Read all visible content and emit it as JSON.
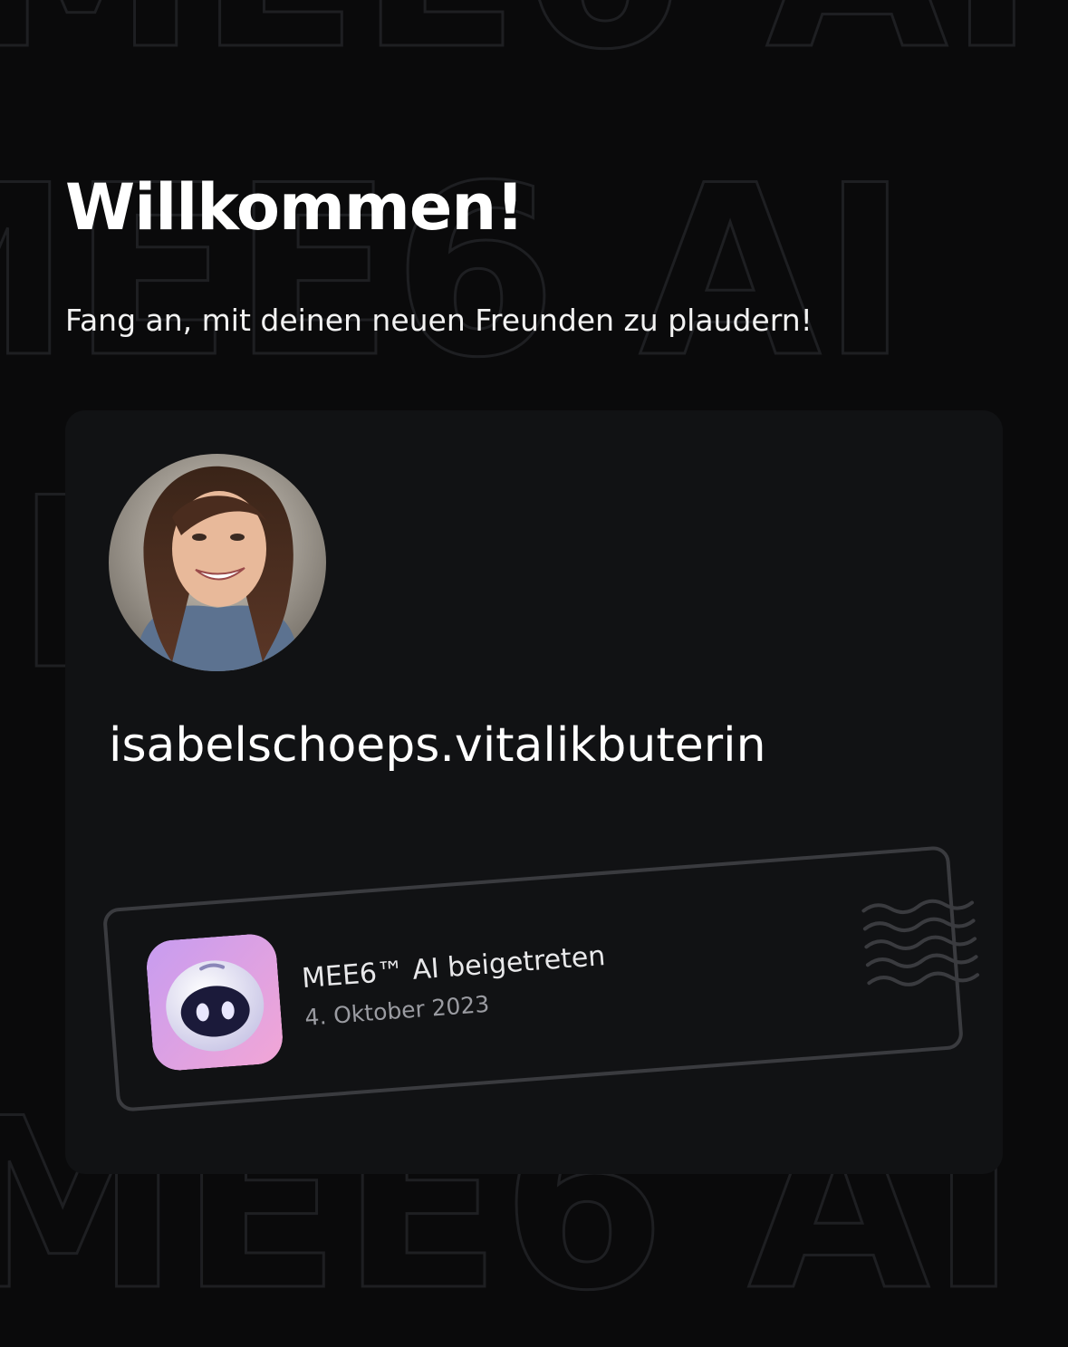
{
  "welcome": {
    "title": "Willkommen!",
    "subtitle": "Fang an, mit deinen neuen Freunden zu plaudern!"
  },
  "background": {
    "watermark_text": "MEE6 AI"
  },
  "profile": {
    "username": "isabelschoeps.vitalikbuterin",
    "avatar": "user-avatar-photo"
  },
  "joined": {
    "server_icon": "mee6-ai-robot-icon",
    "label": "MEE6™ AI beigetreten",
    "date": "4. Oktober 2023"
  },
  "colors": {
    "background": "#0a0a0b",
    "card": "#111214",
    "badge_border": "#3a3b3f",
    "server_icon_gradient": [
      "#c79cf0",
      "#f2a6d6"
    ]
  }
}
